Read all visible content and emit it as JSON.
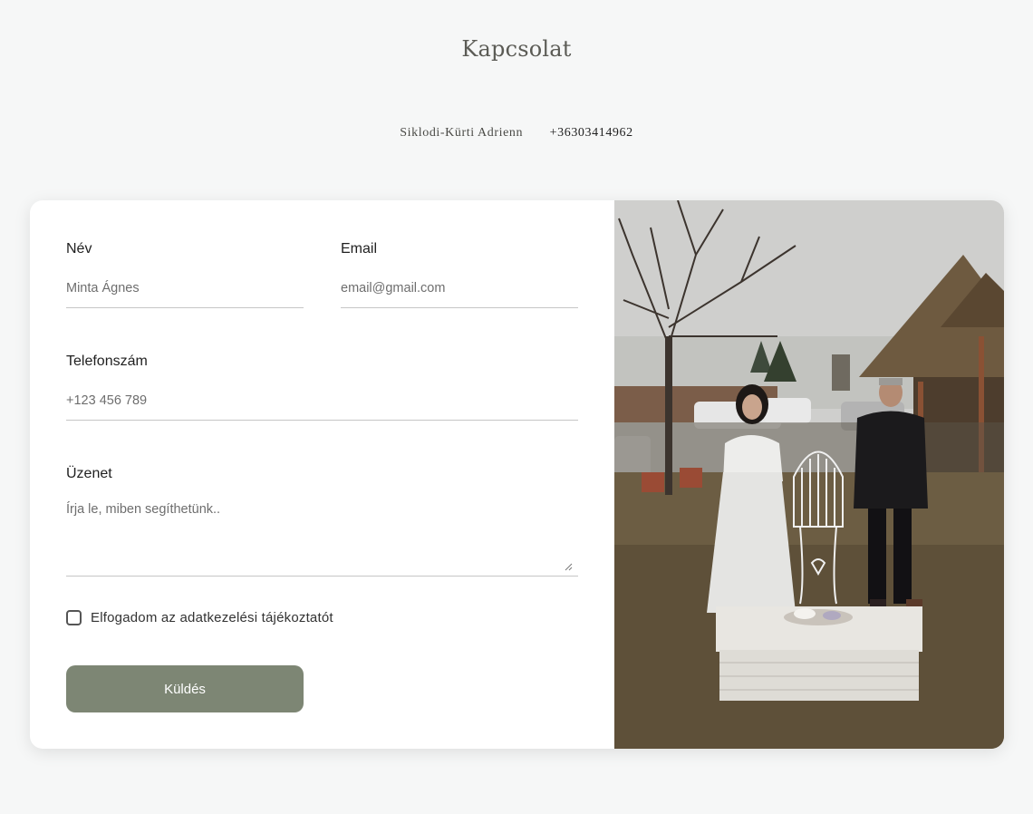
{
  "page": {
    "title": "Kapcsolat",
    "contact_name": "Siklodi-Kürti Adrienn",
    "contact_phone": "+36303414962"
  },
  "form": {
    "name": {
      "label": "Név",
      "placeholder": "Minta Ágnes"
    },
    "email": {
      "label": "Email",
      "placeholder": "email@gmail.com"
    },
    "phone": {
      "label": "Telefonszám",
      "placeholder": "+123 456 789"
    },
    "message": {
      "label": "Üzenet",
      "placeholder": "Írja le, miben segíthetünk.."
    },
    "consent_label": "Elfogadom az adatkezelési tájékoztatót",
    "consent_checked": false,
    "submit_label": "Küldés"
  },
  "colors": {
    "background": "#f6f7f7",
    "button": "#7d8674",
    "title": "#5b5b55"
  }
}
